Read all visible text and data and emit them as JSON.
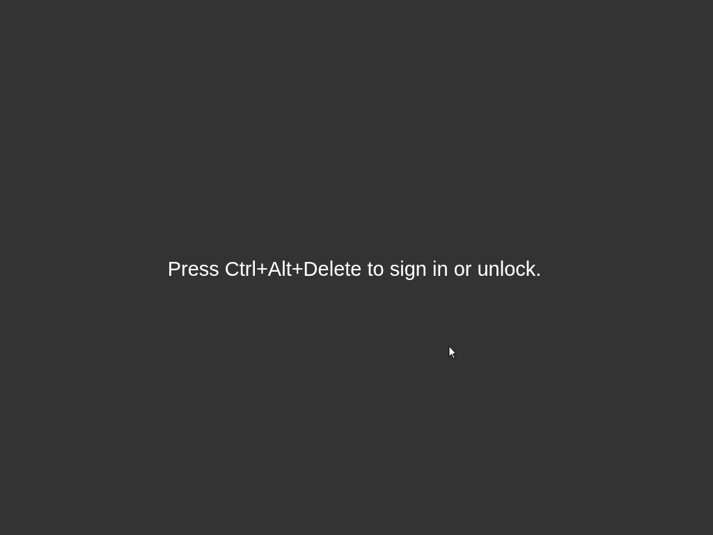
{
  "lock_screen": {
    "message": "Press Ctrl+Alt+Delete to sign in or unlock."
  }
}
